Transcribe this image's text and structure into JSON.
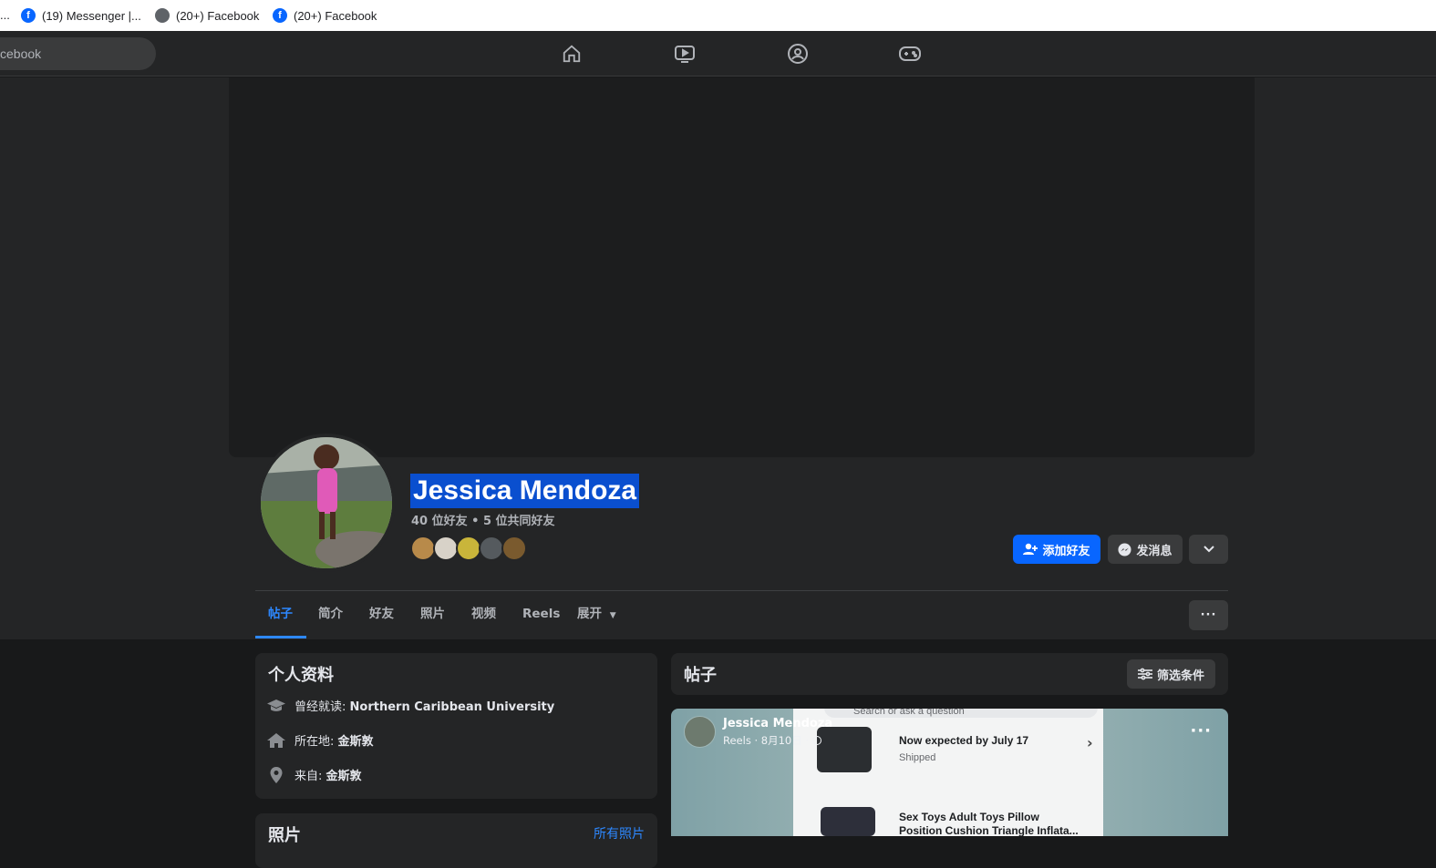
{
  "bookmarks": {
    "ellipsis": "...",
    "items": [
      {
        "label": "(19) Messenger |...",
        "icon": "facebook-icon"
      },
      {
        "label": "(20+) Facebook",
        "icon": "globe-icon"
      },
      {
        "label": "(20+) Facebook",
        "icon": "facebook-icon"
      }
    ]
  },
  "topnav": {
    "search_text": "cebook",
    "icons": [
      "home-icon",
      "video-icon",
      "groups-icon",
      "gaming-icon"
    ]
  },
  "profile": {
    "name": "Jessica Mendoza",
    "friends_summary": "40 位好友 • 5 位共同好友",
    "add_friend": "添加好友",
    "message": "发消息"
  },
  "tabs": [
    "帖子",
    "简介",
    "好友",
    "照片",
    "视频",
    "Reels",
    "展开"
  ],
  "intro": {
    "title": "个人资料",
    "rows": [
      {
        "icon": "education-icon",
        "label": "曾经就读:",
        "value": "Northern Caribbean University"
      },
      {
        "icon": "home-icon",
        "label": "所在地:",
        "value": "金斯敦"
      },
      {
        "icon": "location-pin-icon",
        "label": "来自:",
        "value": "金斯敦"
      }
    ]
  },
  "photos": {
    "title": "照片",
    "link": "所有照片"
  },
  "posts": {
    "title": "帖子",
    "filter": "筛选条件",
    "post": {
      "author": "Jessica Mendoza",
      "meta": "Reels · 8月10日 ·",
      "screenshot": {
        "search": "Search or ask a question",
        "item1_title": "Now expected by July 17",
        "item1_sub": "Shipped",
        "item2_title_line1": "Sex Toys Adult Toys Pillow",
        "item2_title_line2": "Position Cushion Triangle Inflata..."
      }
    }
  },
  "colors": {
    "accent": "#0866ff",
    "link": "#2d88ff",
    "surface": "#242526",
    "background": "#18191a"
  }
}
